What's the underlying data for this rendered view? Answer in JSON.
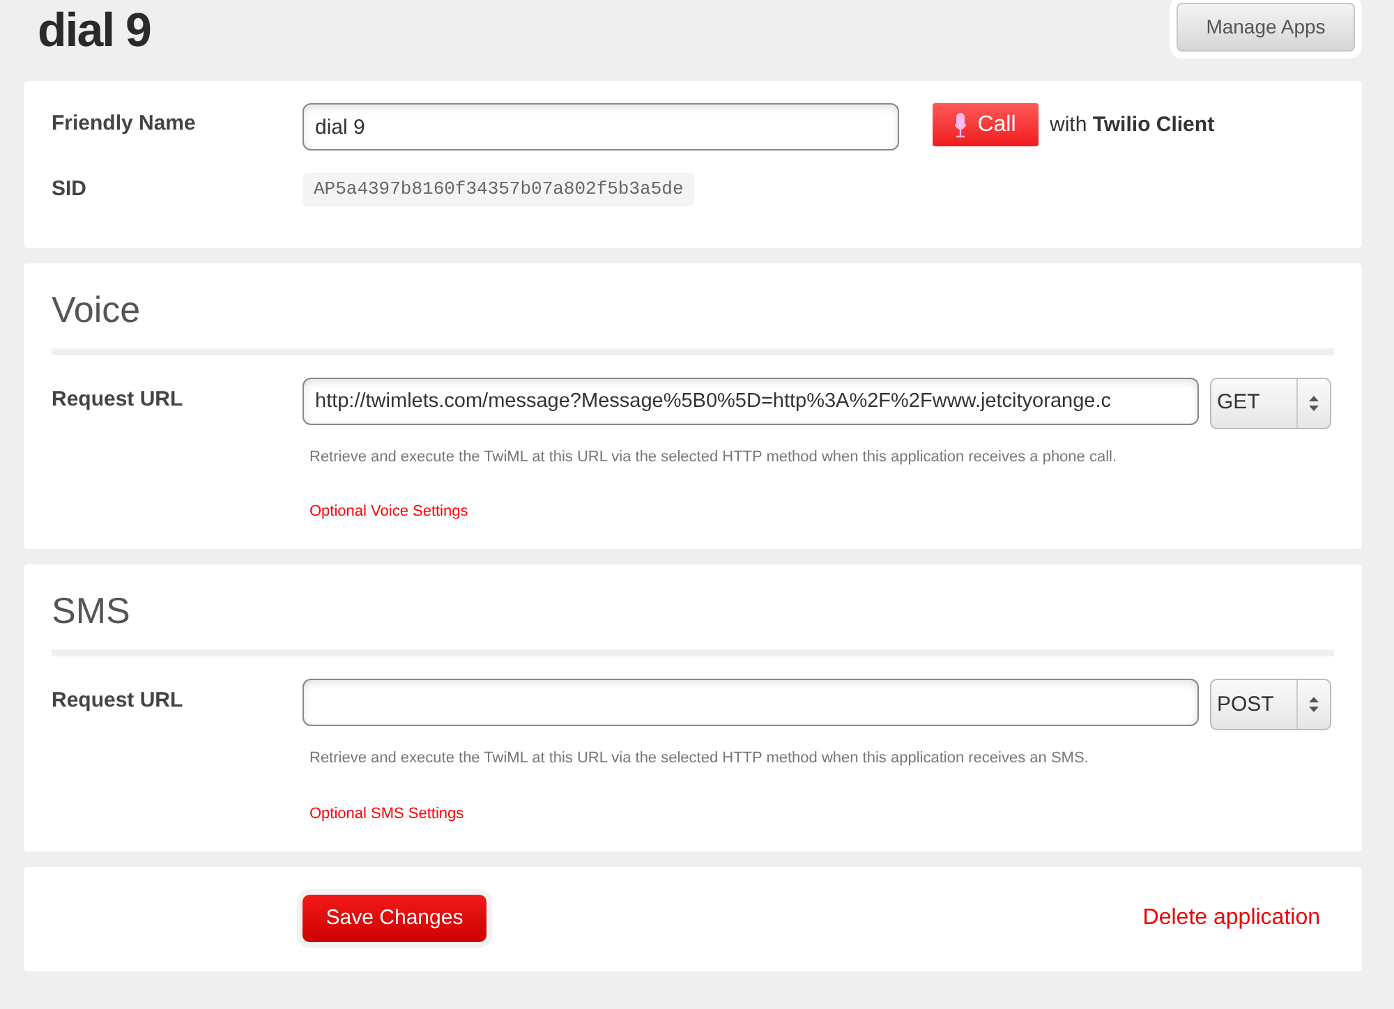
{
  "page": {
    "title": "dial 9",
    "manage_button": "Manage Apps"
  },
  "general": {
    "friendly_name_label": "Friendly Name",
    "friendly_name": "dial 9",
    "call_button": "Call",
    "call_note": "with **Twilio Client**",
    "sid_label": "SID",
    "sid": "AP5a4397b8160f34357b07a802f5b3a5de"
  },
  "sections": [
    {
      "title": "Voice",
      "url_label": "Request URL",
      "url": "http://twimlets.com/message?Message%5B0%5D=http%3A%2F%2Fwww.jetcityorange.c",
      "method": "GET",
      "help": "Retrieve and execute the TwiML at this URL via the selected HTTP method when this application receives a phone call.",
      "options_link": "Optional Voice Settings"
    },
    {
      "title": "SMS",
      "url_label": "Request URL",
      "method": "POST",
      "help": "Retrieve and execute the TwiML at this URL via the selected HTTP method when this application receives an SMS.",
      "options_link": "Optional SMS Settings"
    }
  ],
  "footer": {
    "save_button": "Save Changes",
    "delete_link": "Delete application"
  }
}
